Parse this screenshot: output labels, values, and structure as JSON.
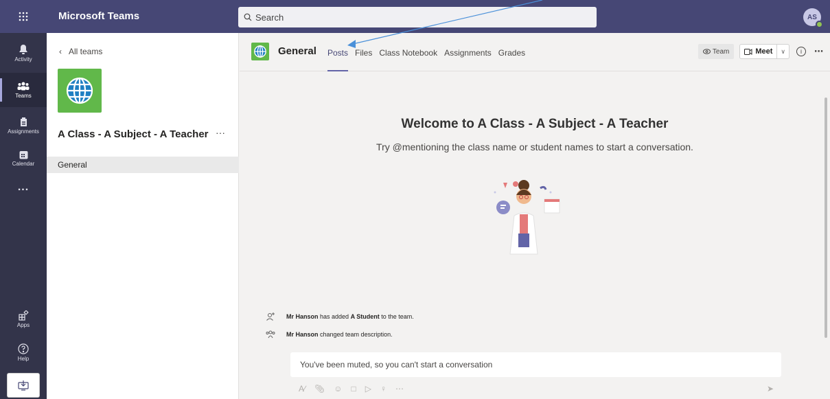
{
  "app": {
    "title": "Microsoft Teams"
  },
  "search": {
    "placeholder": "Search"
  },
  "user": {
    "initials": "AS"
  },
  "rail": {
    "items": [
      {
        "label": "Activity",
        "icon": "bell-icon"
      },
      {
        "label": "Teams",
        "icon": "teams-icon"
      },
      {
        "label": "Assignments",
        "icon": "assignments-icon"
      },
      {
        "label": "Calendar",
        "icon": "calendar-icon"
      },
      {
        "label": "...",
        "icon": "more-icon"
      },
      {
        "label": "Apps",
        "icon": "apps-icon"
      },
      {
        "label": "Help",
        "icon": "help-icon"
      }
    ]
  },
  "teampane": {
    "back_label": "All teams",
    "team_name": "A Class - A Subject - A Teacher",
    "more": "···",
    "channels": [
      "General"
    ]
  },
  "channel": {
    "title": "General",
    "tabs": [
      "Posts",
      "Files",
      "Class Notebook",
      "Assignments",
      "Grades"
    ],
    "team_button": "Team",
    "meet_button": "Meet"
  },
  "welcome": {
    "title": "Welcome to A Class - A Subject - A Teacher",
    "subtitle": "Try @mentioning the class name or student names to start a conversation."
  },
  "activity": [
    {
      "actor": "Mr Hanson",
      "text1": " has added ",
      "target": "A Student",
      "text2": " to the team."
    },
    {
      "actor": "Mr Hanson",
      "text1": " changed team description.",
      "target": "",
      "text2": ""
    }
  ],
  "compose": {
    "muted_text": "You've been muted, so you can't start a conversation"
  },
  "colors": {
    "topbar": "#464775",
    "rail": "#33344a",
    "accent": "#6264a7",
    "team_green": "#61b84a"
  }
}
